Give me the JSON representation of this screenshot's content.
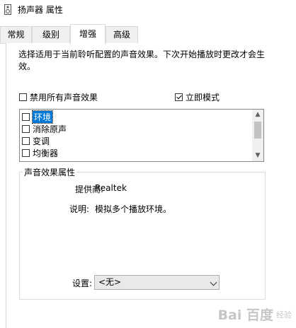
{
  "window": {
    "title": "扬声器 属性",
    "icon": "speaker-icon"
  },
  "tabs": [
    {
      "label": "常规",
      "active": false
    },
    {
      "label": "级别",
      "active": false
    },
    {
      "label": "增强",
      "active": true
    },
    {
      "label": "高级",
      "active": false
    }
  ],
  "enhancements": {
    "description": "选择适用于当前聆听配置的声音效果。下次开始播放时更改才会生效。",
    "disable_all_label": "禁用所有声音效果",
    "disable_all_checked": false,
    "immediate_mode_label": "立即模式",
    "immediate_mode_checked": true,
    "effects": [
      {
        "label": "环境",
        "checked": false,
        "selected": true
      },
      {
        "label": "消除原声",
        "checked": false,
        "selected": false
      },
      {
        "label": "变调",
        "checked": false,
        "selected": false
      },
      {
        "label": "均衡器",
        "checked": false,
        "selected": false
      }
    ]
  },
  "properties": {
    "group_title": "声音效果属性",
    "provider_label": "提供商:",
    "provider_value": "Realtek",
    "description_label": "说明:",
    "description_value": "模拟多个播放环境。",
    "setting_label": "设置:",
    "setting_value": "<无>"
  },
  "watermark": {
    "logo": "Bai  百度",
    "sub": "经验"
  },
  "colors": {
    "selection": "#0078d7",
    "tab_inactive": "#f0f0f0",
    "border": "#d9d9d9"
  }
}
